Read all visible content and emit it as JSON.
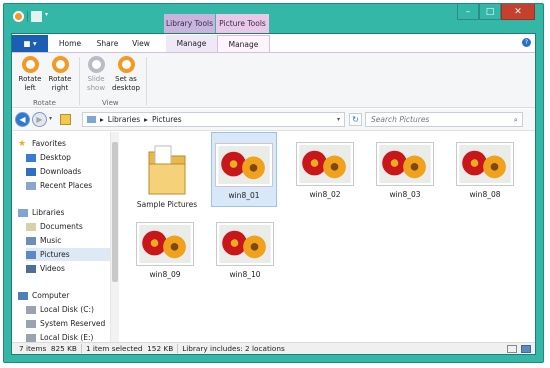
{
  "window": {
    "context_tabs": {
      "library_tools": "Library Tools",
      "picture_tools": "Picture Tools"
    },
    "controls": {
      "minimize": "–",
      "maximize": "□",
      "close": "✕"
    }
  },
  "ribbon_tabs": {
    "file": "■ ▾",
    "home": "Home",
    "share": "Share",
    "view": "View",
    "manage_library": "Manage",
    "manage_picture": "Manage",
    "help": "?"
  },
  "ribbon": {
    "rotate_left": "Rotate left",
    "rotate_right": "Rotate right",
    "slide_show": "Slide show",
    "set_as_desktop": "Set as desktop",
    "group_rotate": "Rotate",
    "group_view": "View"
  },
  "address": {
    "crumb_1": "Libraries",
    "crumb_2": "Pictures",
    "sep": "▸",
    "search_placeholder": "Search Pictures"
  },
  "nav": {
    "favorites": "Favorites",
    "desktop": "Desktop",
    "downloads": "Downloads",
    "recent_places": "Recent Places",
    "libraries": "Libraries",
    "documents": "Documents",
    "music": "Music",
    "pictures": "Pictures",
    "videos": "Videos",
    "computer": "Computer",
    "local_disk_c": "Local Disk (C:)",
    "system_reserved": "System Reserved",
    "local_disk_e": "Local Disk (E:)"
  },
  "files": [
    {
      "name": "Sample Pictures",
      "kind": "folder"
    },
    {
      "name": "win8_01",
      "kind": "image",
      "selected": true
    },
    {
      "name": "win8_02",
      "kind": "image"
    },
    {
      "name": "win8_03",
      "kind": "image"
    },
    {
      "name": "win8_08",
      "kind": "image"
    },
    {
      "name": "win8_09",
      "kind": "image"
    },
    {
      "name": "win8_10",
      "kind": "image"
    }
  ],
  "status": {
    "items": "7 items",
    "size": "825 KB",
    "selected": "1 item selected",
    "selected_size": "152 KB",
    "library_includes": "Library includes: 2 locations"
  },
  "colors": {
    "frame": "#35b7a8",
    "accent": "#f29a24",
    "file_tab": "#1a5fb4",
    "selection": "#d9e8f8"
  }
}
